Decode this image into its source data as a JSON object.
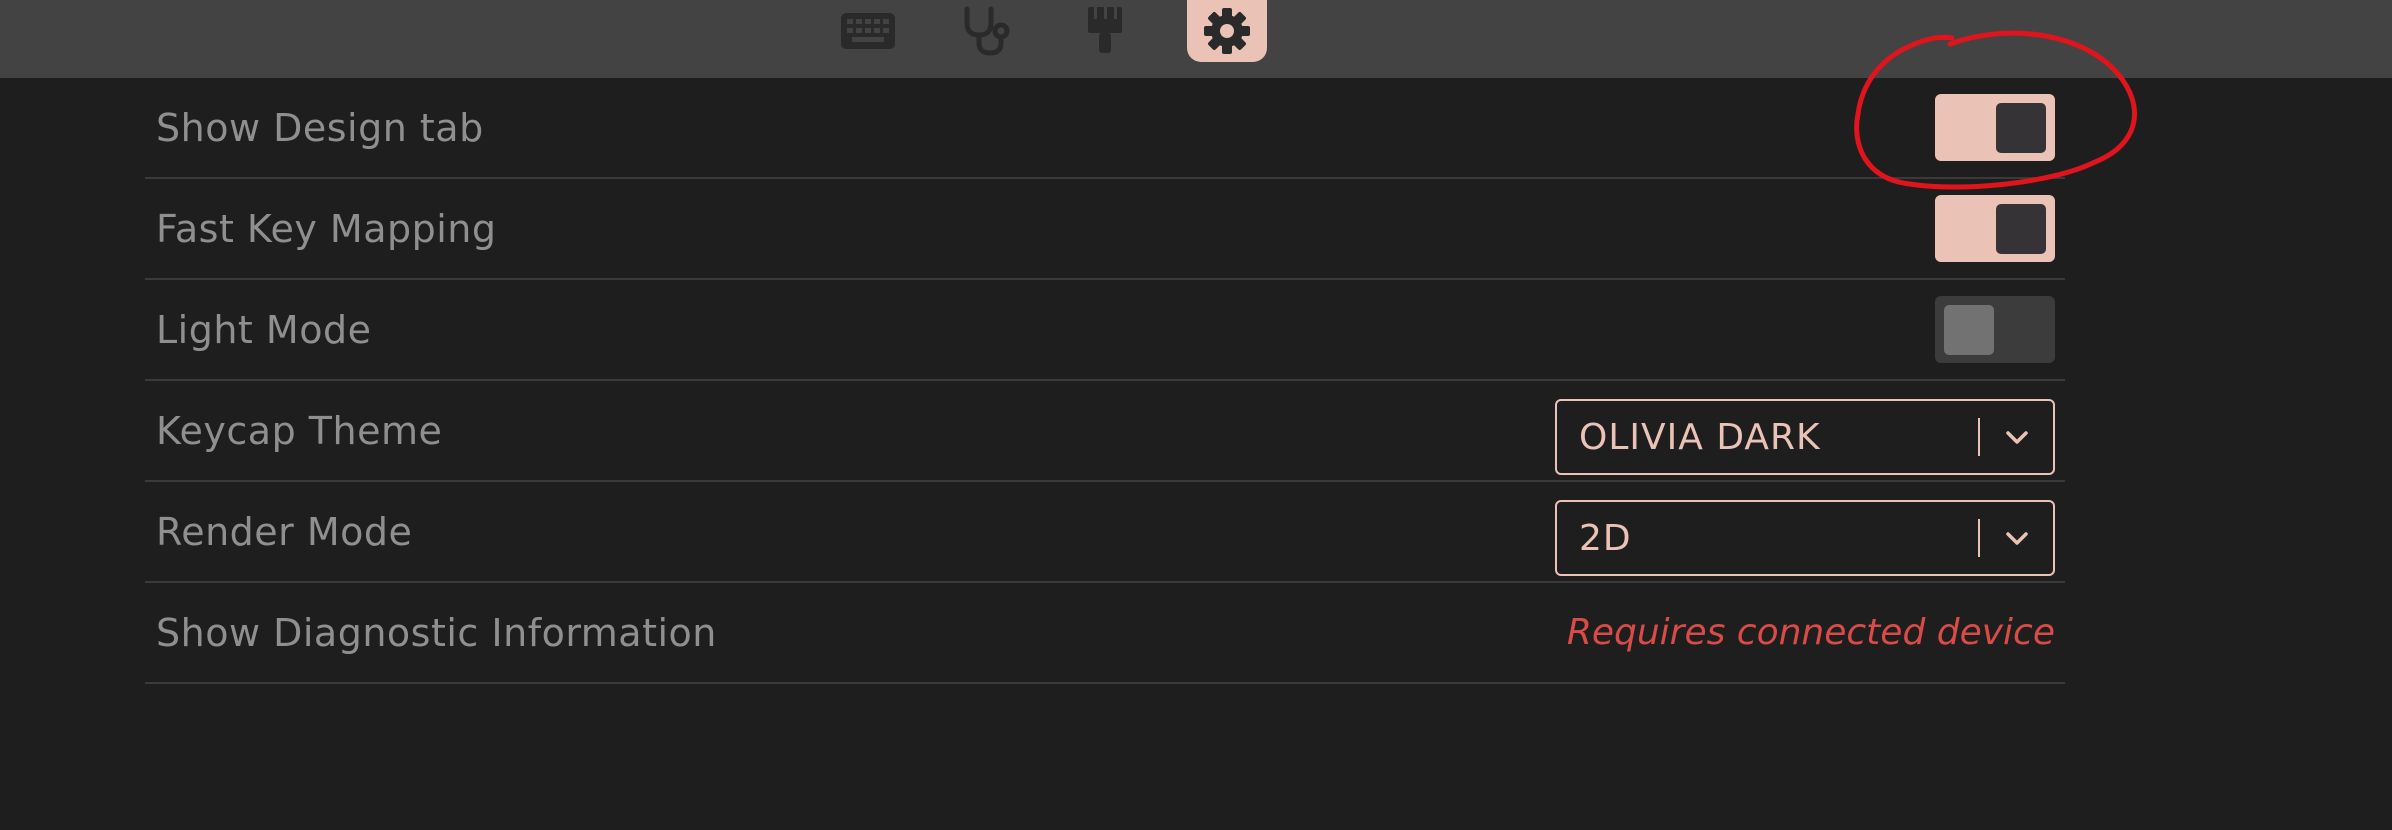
{
  "nav": {
    "tabs": [
      {
        "icon": "keyboard-icon",
        "active": false
      },
      {
        "icon": "stethoscope-icon",
        "active": false
      },
      {
        "icon": "paintbrush-icon",
        "active": false
      },
      {
        "icon": "gear-icon",
        "active": true
      }
    ]
  },
  "settings": {
    "show_design_tab": {
      "label": "Show Design tab",
      "enabled": true
    },
    "fast_key_mapping": {
      "label": "Fast Key Mapping",
      "enabled": true
    },
    "light_mode": {
      "label": "Light Mode",
      "enabled": false
    },
    "keycap_theme": {
      "label": "Keycap Theme",
      "value": "OLIVIA DARK"
    },
    "render_mode": {
      "label": "Render Mode",
      "value": "2D"
    },
    "diagnostics": {
      "label": "Show Diagnostic Information",
      "status": "Requires connected device"
    }
  },
  "colors": {
    "accent": "#ebc2b6",
    "background": "#1f1e1f",
    "topbar": "#434343",
    "error": "#d94b46",
    "annotation": "#e0141c"
  }
}
